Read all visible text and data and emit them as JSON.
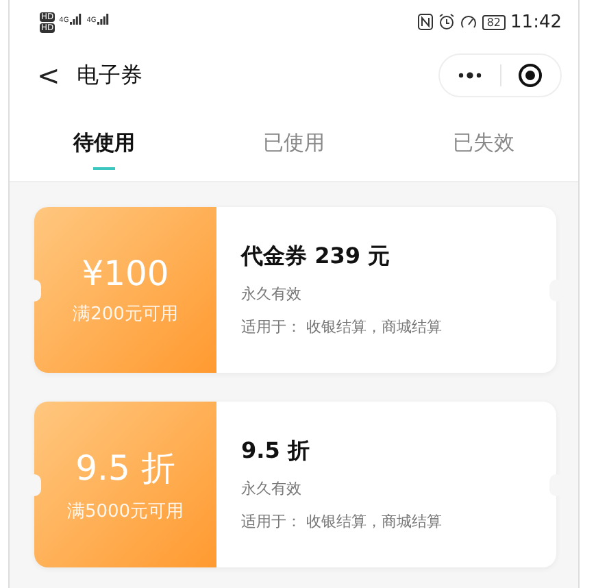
{
  "status_bar": {
    "sims": [
      {
        "hd": "HD",
        "network": "4G"
      },
      {
        "hd": "HD",
        "network": "4G"
      }
    ],
    "battery": "82",
    "time": "11:42"
  },
  "nav": {
    "back": "<",
    "title": "电子券"
  },
  "tabs": [
    {
      "label": "待使用",
      "selected": true
    },
    {
      "label": "已使用",
      "selected": false
    },
    {
      "label": "已失效",
      "selected": false
    }
  ],
  "coupons": [
    {
      "value": "¥100",
      "condition": "满200元可用",
      "name": "代金券 239 元",
      "validity": "永久有效",
      "scope": "适用于： 收银结算，商城结算"
    },
    {
      "value": "9.5 折",
      "condition": "满5000元可用",
      "name": "9.5 折",
      "validity": "永久有效",
      "scope": "适用于： 收银结算，商城结算"
    }
  ]
}
